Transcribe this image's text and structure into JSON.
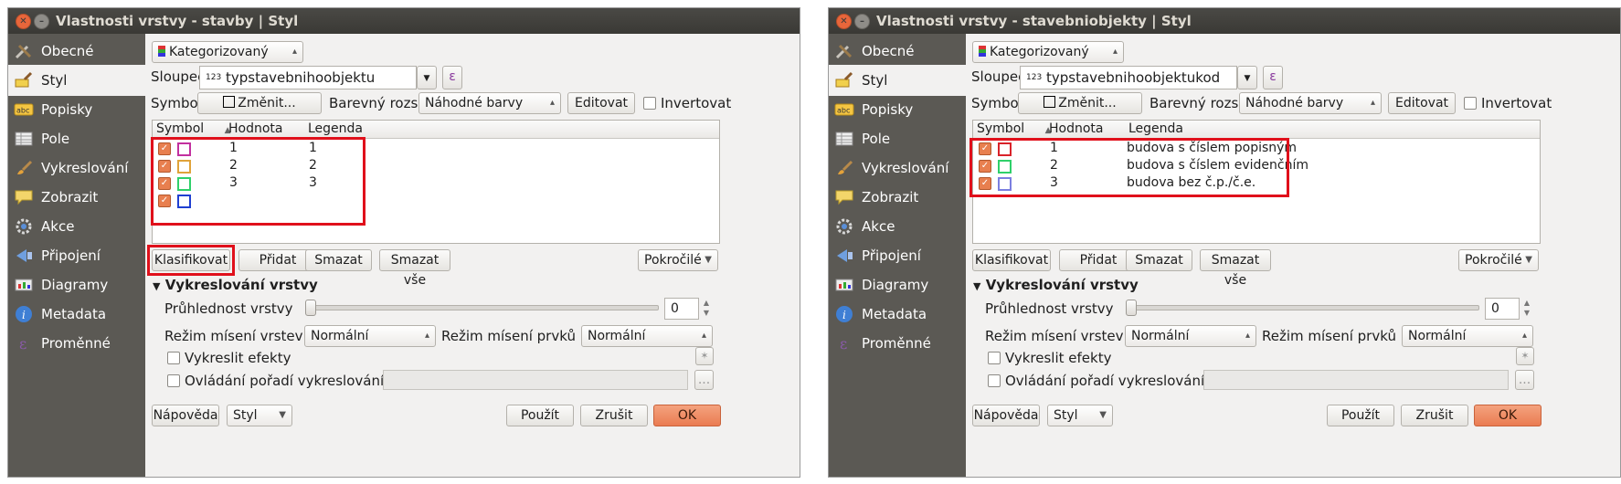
{
  "windows": [
    {
      "title": "Vlastnosti vrstvy - stavby | Styl",
      "sidebar": [
        "Obecné",
        "Styl",
        "Popisky",
        "Pole",
        "Vykreslování",
        "Zobrazit",
        "Akce",
        "Připojení",
        "Diagramy",
        "Metadata",
        "Proměnné"
      ],
      "renderer": "Kategorizovaný",
      "column_label": "Sloupec",
      "column_prefix": "123",
      "column_value": "typstavebnihoobjektu",
      "epsilon": "ε",
      "symbol_label": "Symbol",
      "change_button": "Změnit...",
      "color_ramp_label": "Barevný rozsah",
      "color_ramp_value": "Náhodné barvy",
      "edit_button": "Editovat",
      "invert_label": "Invertovat",
      "headers": [
        "Symbol",
        "Hodnota",
        "Legenda"
      ],
      "rows": [
        {
          "value": "1",
          "legend": "1",
          "color": "#c2309f"
        },
        {
          "value": "2",
          "legend": "2",
          "color": "#e0a33a"
        },
        {
          "value": "3",
          "legend": "3",
          "color": "#2fd06a"
        },
        {
          "value": "",
          "legend": "",
          "color": "#1f3fd1"
        }
      ],
      "buttons": [
        "Klasifikovat",
        "Přidat",
        "Smazat",
        "Smazat vše"
      ],
      "advanced": "Pokročilé",
      "rendering_section": "Vykreslování vrstvy",
      "transparency_label": "Průhlednost vrstvy",
      "transparency_value": "0",
      "blend_layers_label": "Režim mísení vrstev",
      "blend_layers_value": "Normální",
      "blend_features_label": "Režim mísení prvků",
      "blend_features_value": "Normální",
      "effects_label": "Vykreslit efekty",
      "order_label": "Ovládání pořadí vykreslování prvků",
      "dots": "...",
      "help": "Nápověda",
      "style": "Styl",
      "apply": "Použít",
      "cancel": "Zrušit",
      "ok": "OK",
      "highlight_klasifikovat": true
    },
    {
      "title": "Vlastnosti vrstvy - stavebniobjekty | Styl",
      "sidebar": [
        "Obecné",
        "Styl",
        "Popisky",
        "Pole",
        "Vykreslování",
        "Zobrazit",
        "Akce",
        "Připojení",
        "Diagramy",
        "Metadata",
        "Proměnné"
      ],
      "renderer": "Kategorizovaný",
      "column_label": "Sloupec",
      "column_prefix": "123",
      "column_value": "typstavebnihoobjektukod",
      "epsilon": "ε",
      "symbol_label": "Symbol",
      "change_button": "Změnit...",
      "color_ramp_label": "Barevný rozsah",
      "color_ramp_value": "Náhodné barvy",
      "edit_button": "Editovat",
      "invert_label": "Invertovat",
      "headers": [
        "Symbol",
        "Hodnota",
        "Legenda"
      ],
      "rows": [
        {
          "value": "1",
          "legend": " budova s číslem popisným",
          "color": "#d9232a"
        },
        {
          "value": "2",
          "legend": "budova s číslem evidenčním",
          "color": "#2fd06a"
        },
        {
          "value": "3",
          "legend": "budova bez č.p./č.e.",
          "color": "#7b7fe0"
        }
      ],
      "buttons": [
        "Klasifikovat",
        "Přidat",
        "Smazat",
        "Smazat vše"
      ],
      "advanced": "Pokročilé",
      "rendering_section": "Vykreslování vrstvy",
      "transparency_label": "Průhlednost vrstvy",
      "transparency_value": "0",
      "blend_layers_label": "Režim mísení vrstev",
      "blend_layers_value": "Normální",
      "blend_features_label": "Režim mísení prvků",
      "blend_features_value": "Normální",
      "effects_label": "Vykreslit efekty",
      "order_label": "Ovládání pořadí vykreslování prvků",
      "dots": "...",
      "help": "Nápověda",
      "style": "Styl",
      "apply": "Použít",
      "cancel": "Zrušit",
      "ok": "OK",
      "highlight_klasifikovat": false
    }
  ],
  "sidebar_icons": [
    "tools-icon",
    "brush-icon",
    "label-icon",
    "table-icon",
    "paintbrush-icon",
    "speech-bubble-icon",
    "gear-icon",
    "join-icon",
    "diagram-icon",
    "info-icon",
    "variables-icon"
  ]
}
